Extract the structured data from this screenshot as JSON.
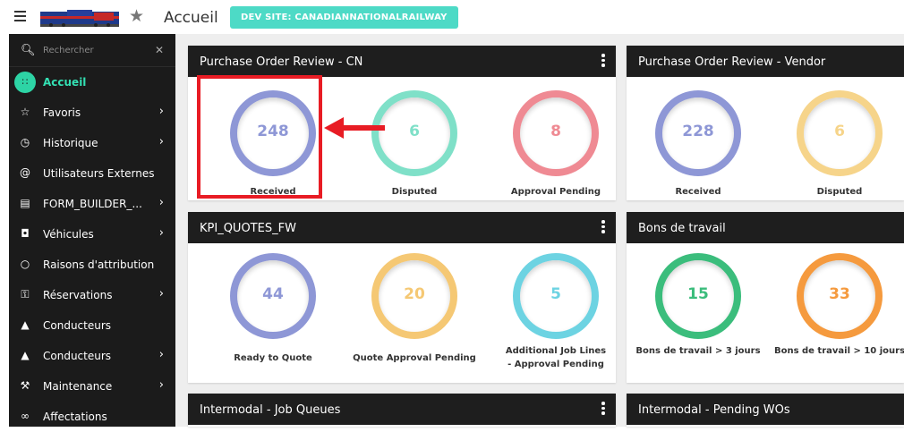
{
  "header": {
    "title": "Accueil",
    "dev_badge": "DEV SITE: CANADIANNATIONALRAILWAY"
  },
  "sidebar": {
    "search_placeholder": "Rechercher",
    "items": [
      {
        "label": "Accueil",
        "icon": "dashboard-icon",
        "chevron": false,
        "active": true
      },
      {
        "label": "Favoris",
        "icon": "star-icon",
        "chevron": true
      },
      {
        "label": "Historique",
        "icon": "clock-icon",
        "chevron": true
      },
      {
        "label": "Utilisateurs Externes",
        "icon": "at-icon",
        "chevron": false
      },
      {
        "label": "FORM_BUILDER_...",
        "icon": "clipboard-icon",
        "chevron": true
      },
      {
        "label": "Véhicules",
        "icon": "car-icon",
        "chevron": true
      },
      {
        "label": "Raisons d'attribution",
        "icon": "circle-icon",
        "chevron": false
      },
      {
        "label": "Réservations",
        "icon": "key-icon",
        "chevron": true
      },
      {
        "label": "Conducteurs",
        "icon": "user-icon",
        "chevron": false
      },
      {
        "label": "Conducteurs",
        "icon": "user-icon",
        "chevron": true
      },
      {
        "label": "Maintenance",
        "icon": "wrench-icon",
        "chevron": true
      },
      {
        "label": "Affectations",
        "icon": "link-icon",
        "chevron": false
      }
    ]
  },
  "cards": [
    {
      "title": "Purchase Order Review - CN",
      "kpis": [
        {
          "value": "248",
          "label": "Received",
          "color": "#8e97d6"
        },
        {
          "value": "6",
          "label": "Disputed",
          "color": "#7fe0c8"
        },
        {
          "value": "8",
          "label": "Approval Pending",
          "color": "#ef8a93"
        }
      ]
    },
    {
      "title": "Purchase Order Review - Vendor",
      "kpis": [
        {
          "value": "228",
          "label": "Received",
          "color": "#8e97d6"
        },
        {
          "value": "6",
          "label": "Disputed",
          "color": "#f6d48a"
        }
      ]
    },
    {
      "title": "KPI_QUOTES_FW",
      "kpis": [
        {
          "value": "44",
          "label": "Ready to Quote",
          "color": "#8e97d6"
        },
        {
          "value": "20",
          "label": "Quote Approval Pending",
          "color": "#f5c874"
        },
        {
          "value": "5",
          "label": "Additional Job Lines - Approval Pending",
          "color": "#6dd3e2"
        }
      ]
    },
    {
      "title": "Bons de travail",
      "kpis": [
        {
          "value": "15",
          "label": "Bons de travail > 3 jours",
          "color": "#3bbd7c"
        },
        {
          "value": "33",
          "label": "Bons de travail > 10 jours",
          "color": "#f59a3e"
        }
      ]
    },
    {
      "title": "Intermodal - Job Queues",
      "kpis": []
    },
    {
      "title": "Intermodal - Pending WOs",
      "kpis": []
    }
  ],
  "colors": {
    "accent": "#2dd4a5",
    "annotation": "#e81c24"
  }
}
